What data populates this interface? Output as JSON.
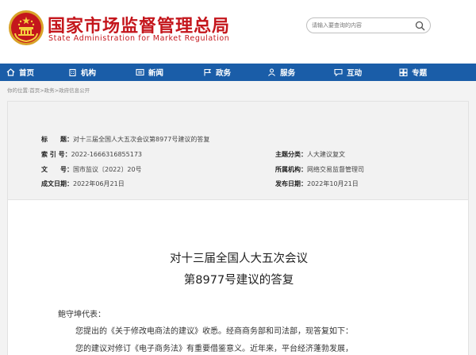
{
  "header": {
    "site_name_cn": "国家市场监督管理总局",
    "site_name_en": "State Administration for Market Regulation",
    "search_placeholder": "请输入要查询的内容",
    "brand_color": "#c4161c"
  },
  "nav": {
    "color": "#1a5da8",
    "items": [
      {
        "label": "首页",
        "icon": "home-icon"
      },
      {
        "label": "机构",
        "icon": "building-icon"
      },
      {
        "label": "新闻",
        "icon": "news-icon"
      },
      {
        "label": "政务",
        "icon": "flag-icon"
      },
      {
        "label": "服务",
        "icon": "service-icon"
      },
      {
        "label": "互动",
        "icon": "chat-icon"
      },
      {
        "label": "专题",
        "icon": "topic-icon"
      }
    ]
  },
  "breadcrumb": "你的位置:首页>政务>政府信息公开",
  "meta": {
    "title_label": "标　　题：",
    "title_value": "对十三届全国人大五次会议第8977号建议的答复",
    "index_label": "索 引 号：",
    "index_value": "2022-1666316855173",
    "category_label": "主题分类：",
    "category_value": "人大建议复文",
    "docno_label": "文　　号：",
    "docno_value": "国市监议〔2022〕20号",
    "agency_label": "所属机构：",
    "agency_value": "网络交易监督管理司",
    "created_label": "成文日期：",
    "created_value": "2022年06月21日",
    "published_label": "发布日期：",
    "published_value": "2022年10月21日"
  },
  "article": {
    "title_line1": "对十三届全国人大五次会议",
    "title_line2": "第8977号建议的答复",
    "salutation": "鲍守坤代表：",
    "para1": "您提出的《关于修改电商法的建议》收悉。经商商务部和司法部，现答复如下：",
    "para2": "您的建议对修订《电子商务法》有重要借鉴意义。近年来，平台经济蓬勃发展，"
  }
}
